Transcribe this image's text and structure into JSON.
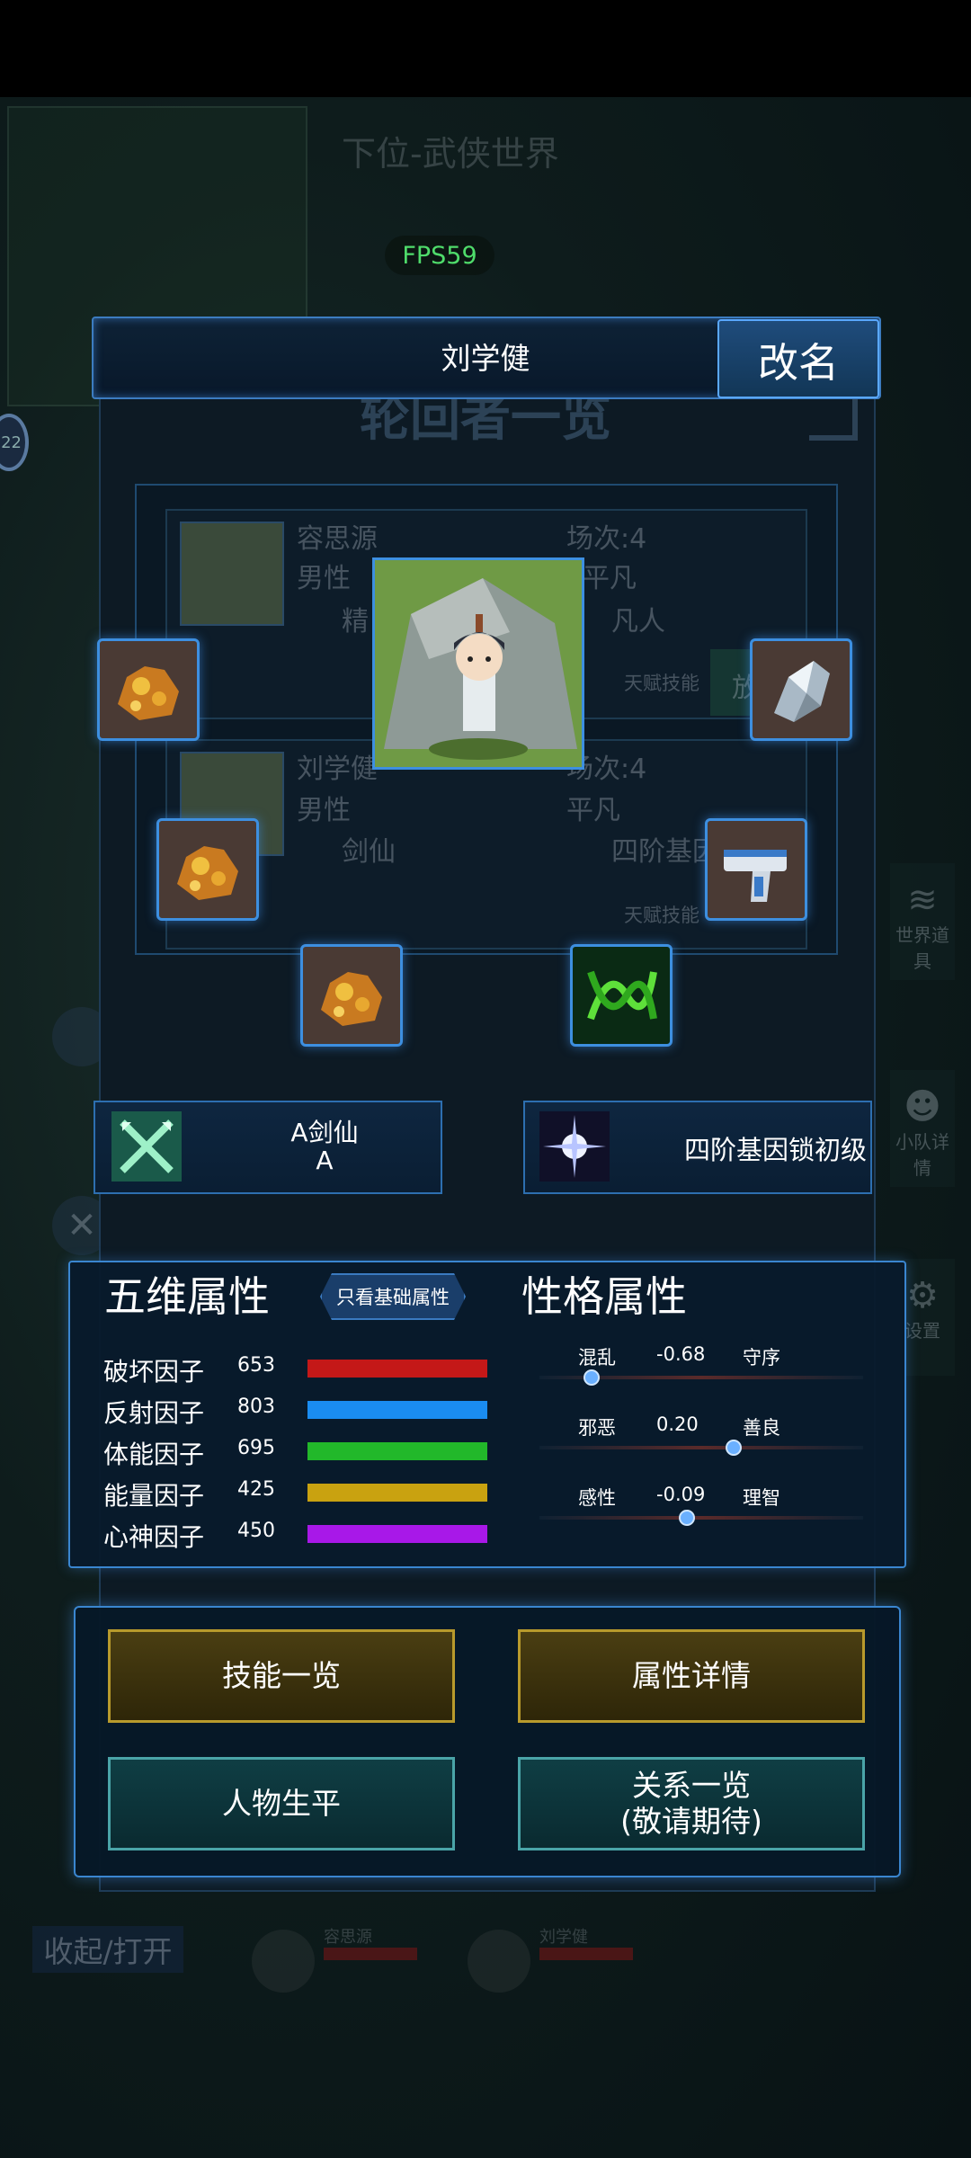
{
  "background": {
    "world_title": "下位-武侠世界",
    "fps_label": "FPS59",
    "side_badge": "22",
    "side_buttons": [
      "世界道具",
      "小队详情",
      "设置"
    ],
    "collapse_label": "收起/打开",
    "team_members": [
      "容思源",
      "刘学健"
    ]
  },
  "panel": {
    "title": "轮回者一览",
    "character_name": "刘学健",
    "rename_label": "改名",
    "cards": [
      {
        "name": "容思源",
        "gender": "男性",
        "talent": "精",
        "rounds": "场次:4",
        "rank": "平凡",
        "rank_talent": "凡人",
        "talent_skill": "天赋技能",
        "action": "放"
      },
      {
        "name": "刘学健",
        "gender": "男性",
        "talent": "剑仙",
        "rounds": "场次:4",
        "rank": "平凡",
        "rank_talent": "四阶基因",
        "talent_skill": "天赋技能"
      }
    ]
  },
  "equipment": {
    "slots": [
      {
        "name": "gold-ore",
        "color": "#d4962a"
      },
      {
        "name": "gold-ore",
        "color": "#d4962a"
      },
      {
        "name": "gold-ore",
        "color": "#d4962a"
      },
      {
        "name": "silver-crystal",
        "color": "#c7d6e0"
      },
      {
        "name": "laser-pistol",
        "color": "#3a7ac8"
      },
      {
        "name": "dna-helix",
        "color": "#5ee03a"
      }
    ]
  },
  "traits": [
    {
      "line1": "A剑仙",
      "line2": "A",
      "icon": "crossed-swords-icon"
    },
    {
      "line1": "四阶基因锁初级",
      "icon": "star-burst-icon"
    }
  ],
  "attributes": {
    "title": "五维属性",
    "filter_label": "只看基础属性",
    "stats": [
      {
        "label": "破坏因子",
        "value": "653",
        "color": "#c41818",
        "max": 1000
      },
      {
        "label": "反射因子",
        "value": "803",
        "color": "#1a8cf0",
        "max": 1000
      },
      {
        "label": "体能因子",
        "value": "695",
        "color": "#22b82a",
        "max": 1000
      },
      {
        "label": "能量因子",
        "value": "425",
        "color": "#c9a210",
        "max": 1000
      },
      {
        "label": "心神因子",
        "value": "450",
        "color": "#a818e8",
        "max": 1000
      }
    ]
  },
  "personality": {
    "title": "性格属性",
    "axes": [
      {
        "left": "混乱",
        "value": "-0.68",
        "right": "守序",
        "level": -0.68
      },
      {
        "left": "邪恶",
        "value": "0.20",
        "right": "善良",
        "level": 0.2
      },
      {
        "left": "感性",
        "value": "-0.09",
        "right": "理智",
        "level": -0.09
      }
    ]
  },
  "actions": {
    "skills": "技能一览",
    "attr_detail": "属性详情",
    "biography": "人物生平",
    "relations_line1": "关系一览",
    "relations_line2": "(敬请期待)"
  }
}
